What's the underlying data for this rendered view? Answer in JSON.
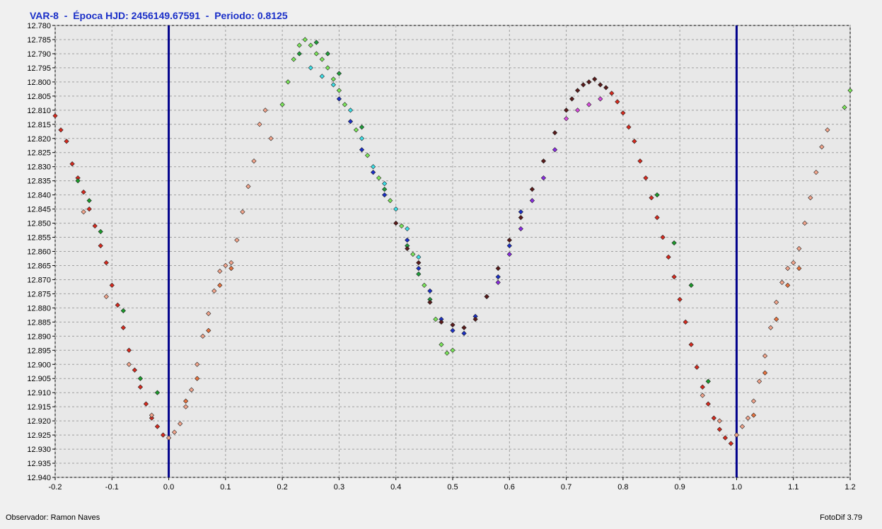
{
  "header": {
    "title": "VAR-8  -  Época HJD: 2456149.67591  -  Periodo: 0.8125"
  },
  "footer": {
    "observer": "Observador: Ramon Naves",
    "software": "FotoDif 3.79"
  },
  "colors": {
    "vline": "#00008b",
    "grid": "#a0a0a0",
    "plot_bg": "#e8e8e8"
  },
  "chart_data": {
    "type": "scatter",
    "title": "VAR-8  -  Época HJD: 2456149.67591  -  Periodo: 0.8125",
    "xlabel": "",
    "ylabel": "",
    "xlim": [
      -0.2,
      1.2
    ],
    "ylim": [
      12.78,
      12.94
    ],
    "y_inverted": true,
    "grid": true,
    "x_ticks": [
      "-0.2",
      "-0.1",
      "0.0",
      "0.1",
      "0.2",
      "0.3",
      "0.4",
      "0.5",
      "0.6",
      "0.7",
      "0.8",
      "0.9",
      "1.0",
      "1.1",
      "1.2"
    ],
    "y_ticks": [
      "12.780",
      "12.785",
      "12.790",
      "12.795",
      "12.800",
      "12.805",
      "12.810",
      "12.815",
      "12.820",
      "12.825",
      "12.830",
      "12.835",
      "12.840",
      "12.845",
      "12.850",
      "12.855",
      "12.860",
      "12.865",
      "12.870",
      "12.875",
      "12.880",
      "12.885",
      "12.890",
      "12.895",
      "12.900",
      "12.905",
      "12.910",
      "12.915",
      "12.920",
      "12.925",
      "12.930",
      "12.935",
      "12.940"
    ],
    "vertical_lines": [
      0.0,
      1.0
    ],
    "series": [
      {
        "color": "#d62a1e",
        "points": [
          [
            -0.2,
            12.812
          ],
          [
            -0.19,
            12.817
          ],
          [
            -0.18,
            12.821
          ],
          [
            -0.17,
            12.829
          ],
          [
            -0.16,
            12.834
          ],
          [
            -0.15,
            12.839
          ],
          [
            -0.14,
            12.845
          ],
          [
            -0.13,
            12.851
          ],
          [
            -0.12,
            12.858
          ],
          [
            -0.11,
            12.864
          ],
          [
            -0.1,
            12.872
          ],
          [
            -0.09,
            12.879
          ],
          [
            -0.08,
            12.887
          ],
          [
            -0.07,
            12.895
          ],
          [
            -0.06,
            12.902
          ],
          [
            -0.05,
            12.908
          ],
          [
            -0.04,
            12.914
          ],
          [
            -0.03,
            12.919
          ],
          [
            -0.02,
            12.922
          ],
          [
            -0.01,
            12.925
          ],
          [
            0.78,
            12.804
          ],
          [
            0.79,
            12.807
          ],
          [
            0.8,
            12.811
          ],
          [
            0.81,
            12.816
          ],
          [
            0.82,
            12.821
          ],
          [
            0.83,
            12.828
          ],
          [
            0.84,
            12.834
          ],
          [
            0.85,
            12.841
          ],
          [
            0.86,
            12.848
          ],
          [
            0.87,
            12.855
          ],
          [
            0.88,
            12.862
          ],
          [
            0.89,
            12.869
          ],
          [
            0.9,
            12.877
          ],
          [
            0.91,
            12.885
          ],
          [
            0.92,
            12.893
          ],
          [
            0.93,
            12.901
          ],
          [
            0.94,
            12.908
          ],
          [
            0.95,
            12.914
          ],
          [
            0.96,
            12.919
          ],
          [
            0.97,
            12.923
          ],
          [
            0.98,
            12.926
          ],
          [
            0.99,
            12.928
          ]
        ]
      },
      {
        "color": "#1b9a2a",
        "points": [
          [
            -0.16,
            12.835
          ],
          [
            -0.14,
            12.842
          ],
          [
            -0.12,
            12.853
          ],
          [
            -0.08,
            12.881
          ],
          [
            -0.05,
            12.905
          ],
          [
            -0.02,
            12.91
          ],
          [
            0.86,
            12.84
          ],
          [
            0.89,
            12.857
          ],
          [
            0.92,
            12.872
          ],
          [
            0.95,
            12.906
          ]
        ]
      },
      {
        "color": "#f3a58c",
        "points": [
          [
            -0.15,
            12.846
          ],
          [
            -0.11,
            12.876
          ],
          [
            -0.07,
            12.9
          ],
          [
            -0.03,
            12.918
          ],
          [
            0.0,
            12.926
          ],
          [
            0.01,
            12.924
          ],
          [
            0.02,
            12.921
          ],
          [
            0.03,
            12.915
          ],
          [
            0.04,
            12.909
          ],
          [
            0.05,
            12.9
          ],
          [
            0.06,
            12.89
          ],
          [
            0.07,
            12.882
          ],
          [
            0.08,
            12.874
          ],
          [
            0.09,
            12.867
          ],
          [
            0.1,
            12.865
          ],
          [
            0.11,
            12.864
          ],
          [
            0.12,
            12.856
          ],
          [
            0.13,
            12.846
          ],
          [
            0.14,
            12.837
          ],
          [
            0.15,
            12.828
          ],
          [
            0.16,
            12.815
          ],
          [
            0.17,
            12.81
          ],
          [
            0.18,
            12.82
          ],
          [
            0.94,
            12.911
          ],
          [
            0.97,
            12.92
          ],
          [
            1.0,
            12.925
          ],
          [
            1.01,
            12.922
          ],
          [
            1.02,
            12.919
          ],
          [
            1.03,
            12.913
          ],
          [
            1.04,
            12.906
          ],
          [
            1.05,
            12.897
          ],
          [
            1.06,
            12.887
          ],
          [
            1.07,
            12.878
          ],
          [
            1.08,
            12.871
          ],
          [
            1.09,
            12.866
          ],
          [
            1.1,
            12.864
          ],
          [
            1.11,
            12.859
          ],
          [
            1.12,
            12.85
          ],
          [
            1.13,
            12.841
          ],
          [
            1.14,
            12.832
          ],
          [
            1.15,
            12.823
          ],
          [
            1.16,
            12.817
          ]
        ]
      },
      {
        "color": "#e8733f",
        "points": [
          [
            0.03,
            12.913
          ],
          [
            0.05,
            12.905
          ],
          [
            0.07,
            12.888
          ],
          [
            0.09,
            12.872
          ],
          [
            0.11,
            12.866
          ],
          [
            1.03,
            12.918
          ],
          [
            1.05,
            12.903
          ],
          [
            1.07,
            12.884
          ],
          [
            1.09,
            12.872
          ],
          [
            1.11,
            12.866
          ]
        ]
      },
      {
        "color": "#7be65a",
        "points": [
          [
            0.2,
            12.808
          ],
          [
            0.21,
            12.8
          ],
          [
            0.22,
            12.792
          ],
          [
            0.23,
            12.787
          ],
          [
            0.24,
            12.785
          ],
          [
            0.25,
            12.787
          ],
          [
            0.26,
            12.79
          ],
          [
            0.27,
            12.792
          ],
          [
            0.28,
            12.795
          ],
          [
            0.29,
            12.799
          ],
          [
            0.3,
            12.803
          ],
          [
            0.31,
            12.808
          ],
          [
            0.33,
            12.817
          ],
          [
            0.35,
            12.826
          ],
          [
            0.37,
            12.834
          ],
          [
            0.39,
            12.842
          ],
          [
            0.41,
            12.851
          ],
          [
            0.43,
            12.861
          ],
          [
            0.45,
            12.872
          ],
          [
            0.47,
            12.884
          ],
          [
            0.48,
            12.893
          ],
          [
            0.49,
            12.896
          ],
          [
            0.5,
            12.895
          ],
          [
            1.19,
            12.809
          ],
          [
            1.2,
            12.803
          ]
        ]
      },
      {
        "color": "#1f9d3b",
        "points": [
          [
            0.23,
            12.79
          ],
          [
            0.26,
            12.786
          ],
          [
            0.28,
            12.79
          ],
          [
            0.3,
            12.797
          ],
          [
            0.34,
            12.816
          ],
          [
            0.38,
            12.838
          ],
          [
            0.42,
            12.858
          ],
          [
            0.44,
            12.868
          ],
          [
            0.46,
            12.877
          ]
        ]
      },
      {
        "color": "#3ce0e8",
        "points": [
          [
            0.25,
            12.795
          ],
          [
            0.27,
            12.798
          ],
          [
            0.29,
            12.801
          ],
          [
            0.32,
            12.81
          ],
          [
            0.34,
            12.82
          ],
          [
            0.36,
            12.83
          ],
          [
            0.38,
            12.836
          ],
          [
            0.4,
            12.845
          ],
          [
            0.42,
            12.852
          ],
          [
            0.44,
            12.862
          ]
        ]
      },
      {
        "color": "#1a2fc8",
        "points": [
          [
            0.3,
            12.806
          ],
          [
            0.32,
            12.814
          ],
          [
            0.34,
            12.824
          ],
          [
            0.36,
            12.832
          ],
          [
            0.38,
            12.84
          ],
          [
            0.42,
            12.856
          ],
          [
            0.44,
            12.866
          ],
          [
            0.46,
            12.874
          ],
          [
            0.48,
            12.884
          ],
          [
            0.5,
            12.888
          ],
          [
            0.52,
            12.889
          ],
          [
            0.54,
            12.883
          ],
          [
            0.56,
            12.876
          ],
          [
            0.58,
            12.869
          ],
          [
            0.6,
            12.858
          ],
          [
            0.62,
            12.846
          ]
        ]
      },
      {
        "color": "#5a1a1a",
        "points": [
          [
            0.4,
            12.85
          ],
          [
            0.42,
            12.859
          ],
          [
            0.44,
            12.864
          ],
          [
            0.46,
            12.878
          ],
          [
            0.48,
            12.885
          ],
          [
            0.5,
            12.886
          ],
          [
            0.52,
            12.887
          ],
          [
            0.54,
            12.884
          ],
          [
            0.56,
            12.876
          ],
          [
            0.58,
            12.866
          ],
          [
            0.6,
            12.856
          ],
          [
            0.62,
            12.848
          ],
          [
            0.64,
            12.838
          ],
          [
            0.66,
            12.828
          ],
          [
            0.68,
            12.818
          ],
          [
            0.7,
            12.81
          ],
          [
            0.71,
            12.806
          ],
          [
            0.72,
            12.803
          ],
          [
            0.73,
            12.801
          ],
          [
            0.74,
            12.8
          ],
          [
            0.75,
            12.799
          ],
          [
            0.76,
            12.801
          ],
          [
            0.77,
            12.802
          ]
        ]
      },
      {
        "color": "#8a2be2",
        "points": [
          [
            0.58,
            12.871
          ],
          [
            0.6,
            12.861
          ],
          [
            0.62,
            12.852
          ],
          [
            0.64,
            12.842
          ],
          [
            0.66,
            12.834
          ],
          [
            0.68,
            12.824
          ]
        ]
      },
      {
        "color": "#d94adf",
        "points": [
          [
            0.7,
            12.813
          ],
          [
            0.72,
            12.81
          ],
          [
            0.74,
            12.808
          ],
          [
            0.76,
            12.806
          ]
        ]
      }
    ]
  }
}
